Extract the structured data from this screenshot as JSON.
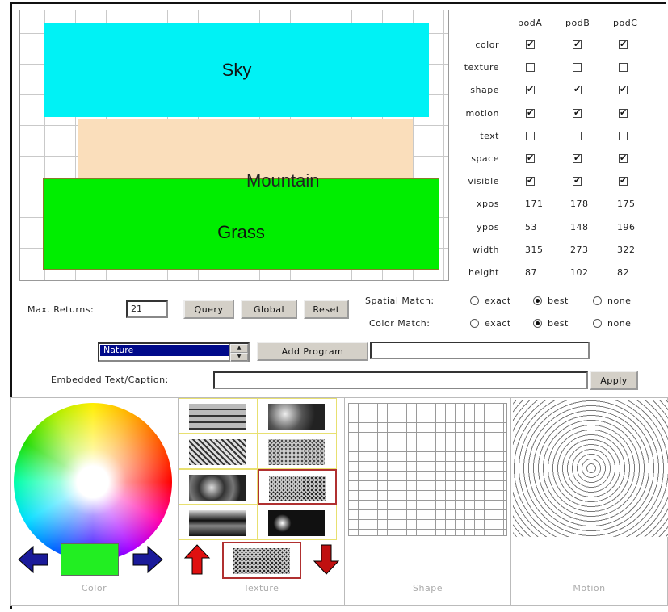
{
  "canvas": {
    "regions": [
      {
        "label": "Sky",
        "color": "#00f2f5"
      },
      {
        "label": "Mountain",
        "color": "#fadebb"
      },
      {
        "label": "Grass",
        "color": "#00ee00"
      }
    ]
  },
  "pods": {
    "headers": [
      "podA",
      "podB",
      "podC"
    ],
    "check_rows": [
      {
        "label": "color",
        "values": [
          true,
          true,
          true
        ]
      },
      {
        "label": "texture",
        "values": [
          false,
          false,
          false
        ]
      },
      {
        "label": "shape",
        "values": [
          true,
          true,
          true
        ]
      },
      {
        "label": "motion",
        "values": [
          true,
          true,
          true
        ]
      },
      {
        "label": "text",
        "values": [
          false,
          false,
          false
        ]
      },
      {
        "label": "space",
        "values": [
          true,
          true,
          true
        ]
      },
      {
        "label": "visible",
        "values": [
          true,
          true,
          true
        ]
      }
    ],
    "value_rows": [
      {
        "label": "xpos",
        "values": [
          "171",
          "178",
          "175"
        ]
      },
      {
        "label": "ypos",
        "values": [
          "53",
          "148",
          "196"
        ]
      },
      {
        "label": "width",
        "values": [
          "315",
          "273",
          "322"
        ]
      },
      {
        "label": "height",
        "values": [
          "87",
          "102",
          "82"
        ]
      }
    ]
  },
  "query": {
    "max_returns_label": "Max. Returns:",
    "max_returns_value": "21",
    "query_button": "Query",
    "global_button": "Global",
    "reset_button": "Reset"
  },
  "spatial_match": {
    "label": "Spatial Match:",
    "options": [
      "exact",
      "best",
      "none"
    ],
    "selected": "best"
  },
  "color_match": {
    "label": "Color Match:",
    "options": [
      "exact",
      "best",
      "none"
    ],
    "selected": "best"
  },
  "program": {
    "selected": "Nature",
    "add_button": "Add Program",
    "program_field": ""
  },
  "caption": {
    "label": "Embedded Text/Caption:",
    "value": "",
    "apply_button": "Apply"
  },
  "panels": {
    "color": {
      "label": "Color",
      "swatch": "#22ee22"
    },
    "texture": {
      "label": "Texture"
    },
    "shape": {
      "label": "Shape"
    },
    "motion": {
      "label": "Motion"
    }
  },
  "icons": {
    "left_arrow": "arrow-left-icon",
    "right_arrow": "arrow-right-icon",
    "up_arrow": "arrow-up-icon",
    "down_arrow": "arrow-down-icon"
  }
}
